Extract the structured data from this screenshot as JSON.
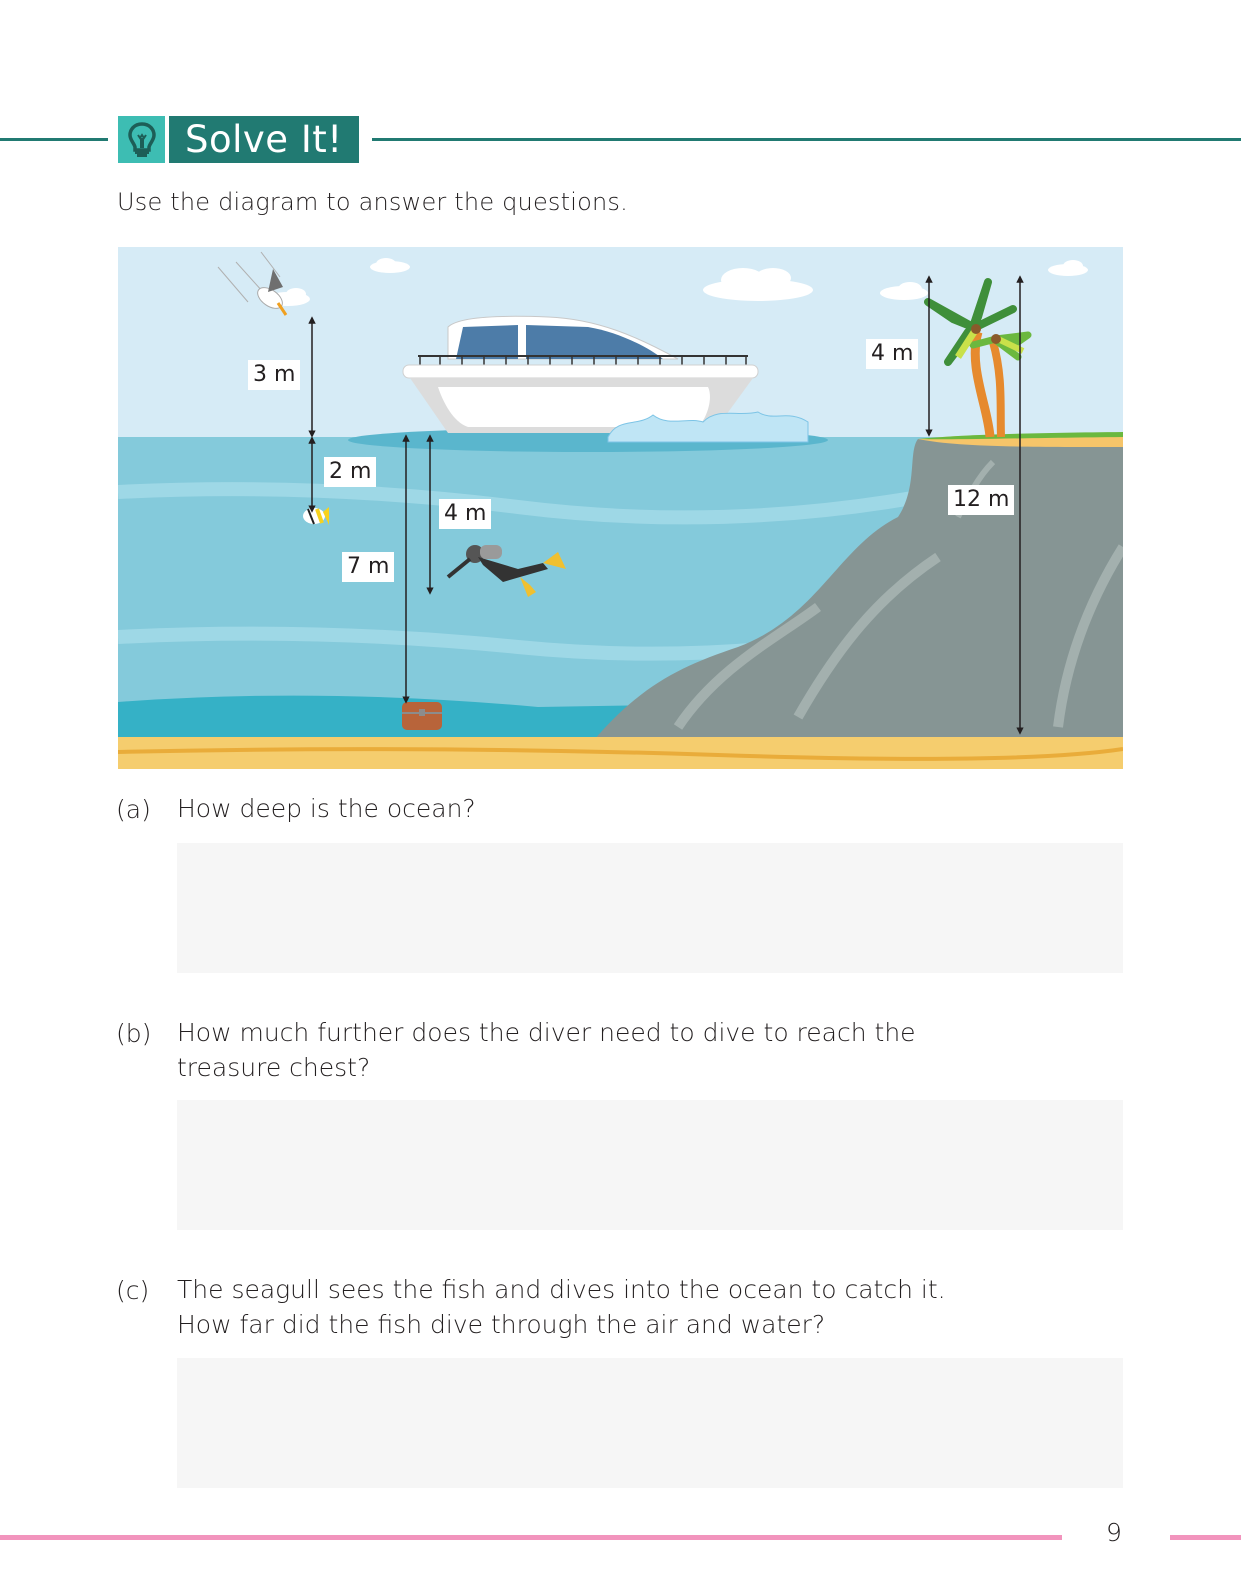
{
  "header": {
    "title": "Solve It!",
    "icon": "lightbulb-icon"
  },
  "instructions": "Use the diagram to answer the questions.",
  "diagram": {
    "labels": {
      "seagull_height": "3 m",
      "fish_depth": "2 m",
      "diver_depth": "4 m",
      "ocean_depth": "7 m",
      "tree_height": "4 m",
      "cliff_height": "12 m"
    },
    "objects": [
      "seagull",
      "boat",
      "fish",
      "diver",
      "treasure-chest",
      "palm-trees",
      "cliff",
      "clouds"
    ]
  },
  "questions": [
    {
      "letter": "(a)",
      "text": "How deep is the ocean?",
      "answer": ""
    },
    {
      "letter": "(b)",
      "text": "How much further does the diver need to dive to reach the treasure chest?",
      "answer": ""
    },
    {
      "letter": "(c)",
      "text": "The seagull sees the fish and dives into the ocean to catch it. How far did the fish dive through the air and water?",
      "answer": ""
    }
  ],
  "footer": {
    "page_number": "9"
  },
  "colors": {
    "accent_dark": "#217a72",
    "accent_light": "#3dbdb3",
    "footer_rule": "#f294bd"
  }
}
